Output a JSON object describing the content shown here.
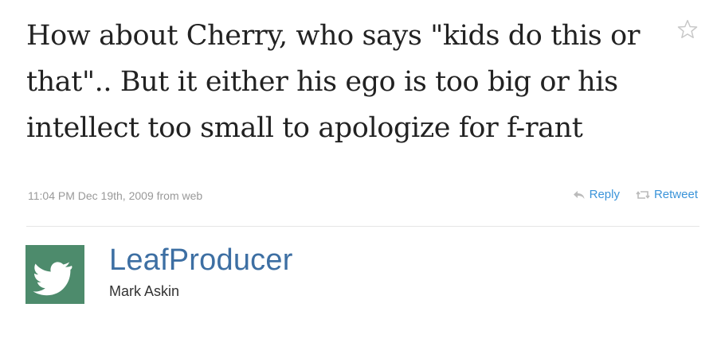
{
  "tweet": {
    "text": "How about Cherry, who says \"kids do this or that\".. But it either his ego is too big or his intellect too small to apologize for f-rant",
    "timestamp": "11:04 PM Dec 19th, 2009",
    "source": "from web",
    "actions": {
      "reply_label": "Reply",
      "retweet_label": "Retweet",
      "favorite_icon": "star-icon"
    }
  },
  "author": {
    "screen_name": "LeafProducer",
    "full_name": "Mark Askin",
    "avatar_icon": "twitter-bird-icon"
  },
  "colors": {
    "link": "#3b94d9",
    "screen_name": "#3d6fa3",
    "meta": "#999999",
    "avatar_bg": "#4d8b6c",
    "text": "#222222"
  }
}
